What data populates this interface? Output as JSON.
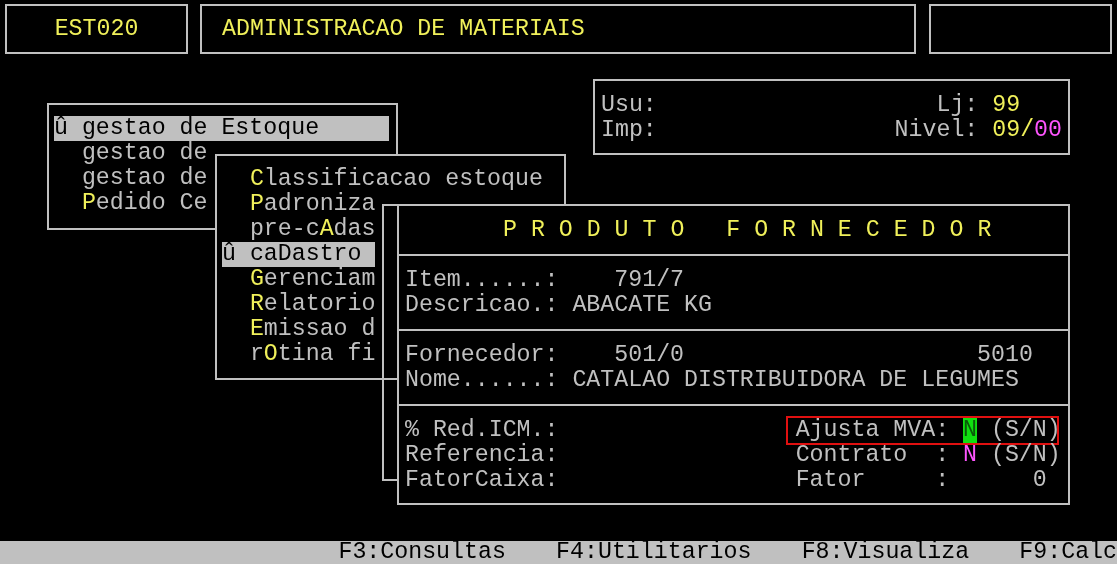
{
  "header": {
    "program_code": "EST020",
    "system_title": "ADMINISTRACAO DE MATERIAIS"
  },
  "session": {
    "user_label": "Usu:",
    "printer_label": "Imp:",
    "store_label": "Lj:",
    "store": "99",
    "level_label": "Nivel:",
    "level_value": "09/",
    "level_suffix": "00"
  },
  "main_menu": {
    "items": [
      {
        "marker": "û",
        "rest": "gestao de Estoque",
        "selected": true
      },
      {
        "rest": "gestao de",
        "selected": false
      },
      {
        "rest": "gestao de",
        "selected": false
      },
      {
        "hotkey": "P",
        "rest": "edido Ce",
        "selected": false
      }
    ]
  },
  "sub_menu": {
    "items": [
      {
        "hotkey": "C",
        "rest": "lassificacao estoque",
        "selected": false
      },
      {
        "hotkey": "P",
        "rest": "adroniza",
        "selected": false
      },
      {
        "prefix": "pre-c",
        "hotkey": "A",
        "rest": "das",
        "selected": false
      },
      {
        "marker": "û",
        "rest": "caDastro",
        "selected": true
      },
      {
        "hotkey": "G",
        "rest": "erenciam",
        "selected": false
      },
      {
        "hotkey": "R",
        "rest": "elatorio",
        "selected": false
      },
      {
        "hotkey": "E",
        "rest": "missao d",
        "selected": false
      },
      {
        "prefix": "r",
        "hotkey": "O",
        "rest": "tina fi",
        "selected": false
      }
    ]
  },
  "product": {
    "title": "P R O D U T O   F O R N E C E D O R",
    "item": {
      "label": "Item......:",
      "value": "791/7"
    },
    "description": {
      "label": "Descricao.:",
      "value": "ABACATE KG"
    },
    "supplier": {
      "label": "Fornecedor:",
      "value": "501/0",
      "code": "5010"
    },
    "name": {
      "label": "Nome......:",
      "value": "CATALAO DISTRIBUIDORA DE LEGUMES"
    },
    "icms_reduction": {
      "label": "% Red.ICM.:"
    },
    "reference": {
      "label": "Referencia:"
    },
    "box_factor": {
      "label": "FatorCaixa:"
    },
    "adjust_mva": {
      "label": "Ajusta MVA:",
      "value": "N",
      "hint": "(S/N)",
      "focused": true,
      "highlighted": true
    },
    "contract": {
      "label": "Contrato  :",
      "value": "N",
      "hint": "(S/N)",
      "focused": false,
      "highlighted": false
    },
    "factor": {
      "label": "Fator     :",
      "value": "0"
    }
  },
  "function_keys": [
    "F3:Consultas",
    "F4:Utilitarios",
    "F8:Visualiza",
    "F9:Calc"
  ]
}
